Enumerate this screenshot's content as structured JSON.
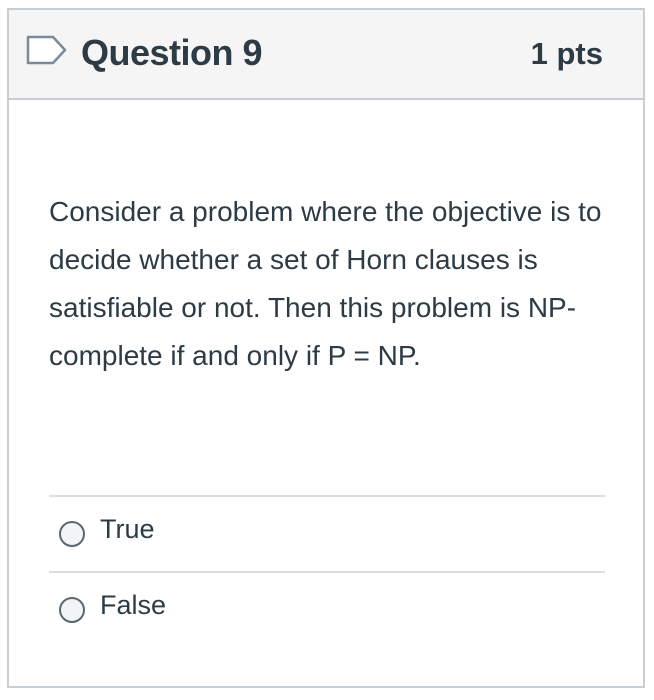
{
  "question": {
    "title": "Question 9",
    "points": "1 pts",
    "flag_icon": "flag-outline-icon",
    "text": "Consider a problem where the objective is to decide whether a set of Horn clauses is satisfiable or not. Then this problem is NP-complete if and only if P = NP."
  },
  "answers": [
    {
      "label": "True",
      "selected": false
    },
    {
      "label": "False",
      "selected": false
    }
  ],
  "colors": {
    "header_background": "#f5f5f5",
    "border": "#c7cdd1",
    "text": "#2d3b45",
    "flag": "#7c8a97"
  }
}
